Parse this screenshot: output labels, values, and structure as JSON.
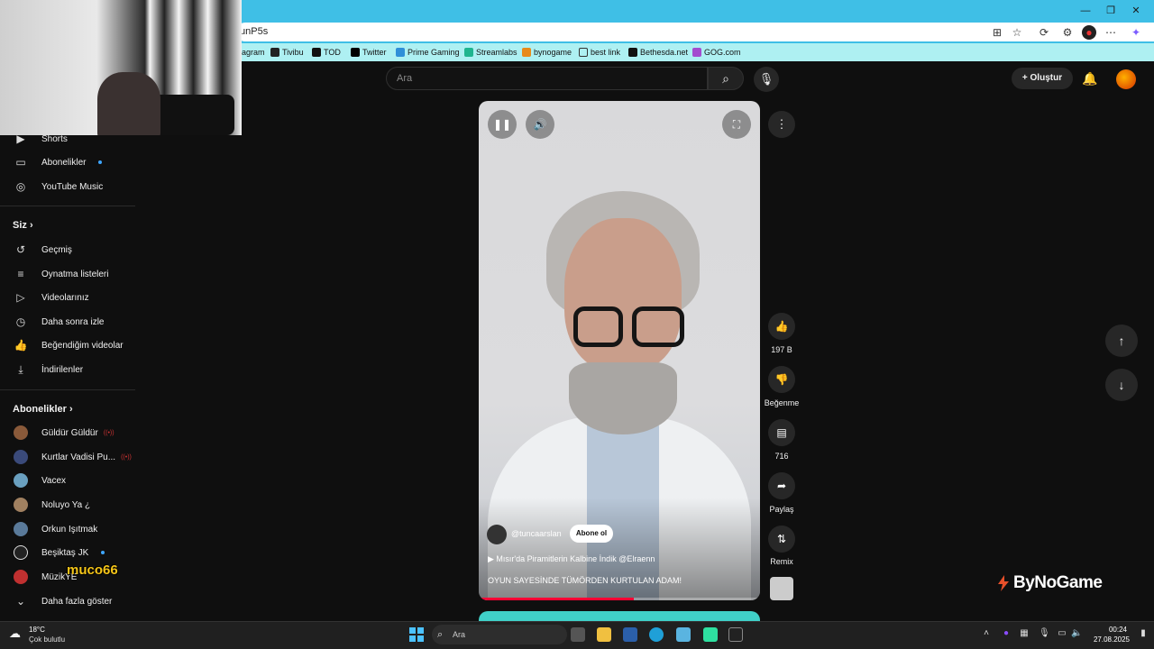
{
  "browser": {
    "url_fragment": "unP5s",
    "bookmarks": [
      "agram",
      "Tivibu",
      "TOD",
      "Twitter",
      "Prime Gaming",
      "Streamlabs",
      "bynogame",
      "best link",
      "Bethesda.net",
      "GOG.com"
    ]
  },
  "topbar": {
    "search_placeholder": "Ara",
    "create_label": "Oluştur"
  },
  "sidebar": {
    "main_items": [
      {
        "label": "Shorts",
        "icon": "shorts-icon"
      },
      {
        "label": "Abonelikler",
        "icon": "subscriptions-icon"
      },
      {
        "label": "YouTube Music",
        "icon": "music-icon"
      }
    ],
    "you_header": "Siz",
    "you_items": [
      {
        "label": "Geçmiş",
        "icon": "history-icon"
      },
      {
        "label": "Oynatma listeleri",
        "icon": "playlist-icon"
      },
      {
        "label": "Videolarınız",
        "icon": "your-videos-icon"
      },
      {
        "label": "Daha sonra izle",
        "icon": "clock-icon"
      },
      {
        "label": "Beğendiğim videolar",
        "icon": "thumbs-up-icon"
      },
      {
        "label": "İndirilenler",
        "icon": "download-icon"
      }
    ],
    "subs_header": "Abonelikler",
    "channels": [
      {
        "label": "Güldür Güldür",
        "live": true,
        "dot": false,
        "color": "#8a5a3a"
      },
      {
        "label": "Kurtlar Vadisi Pu...",
        "live": true,
        "dot": false,
        "color": "#3a4a7a"
      },
      {
        "label": "Vacex",
        "live": false,
        "dot": false,
        "color": "#6aa0c0"
      },
      {
        "label": "Noluyo Ya ¿",
        "live": false,
        "dot": false,
        "color": "#a08060"
      },
      {
        "label": "Orkun Işıtmak",
        "live": false,
        "dot": false,
        "color": "#5a7a9a"
      },
      {
        "label": "Beşiktaş JK",
        "live": false,
        "dot": true,
        "color": "#222222"
      },
      {
        "label": "MüzikYE",
        "live": false,
        "dot": false,
        "color": "#c03030"
      }
    ],
    "show_more": "Daha fazla göster"
  },
  "video": {
    "channel": "@tuncaarslan",
    "subscribe_label": "Abone ol",
    "title": "Mısır'da Piramitlerin Kalbine İndik @Elraenn",
    "caption": "OYUN SAYESİNDE TÜMÖRDEN KURTULAN ADAM!",
    "progress": 0.55
  },
  "actions": {
    "likes": "197 B",
    "dislike_label": "Beğenme",
    "comments": "716",
    "share_label": "Paylaş",
    "remix_label": "Remix"
  },
  "overlays": {
    "bynogame": "ByNoGame",
    "streamer": "muco66"
  },
  "taskbar": {
    "temp": "18°C",
    "weather": "Çok bulutlu",
    "search_label": "Ara",
    "time": "00:24",
    "date": "27.08.2025"
  },
  "colors": {
    "accent_blue": "#3ea6ff",
    "progress_red": "#ff0033",
    "titlebar": "#3fbfe6"
  }
}
